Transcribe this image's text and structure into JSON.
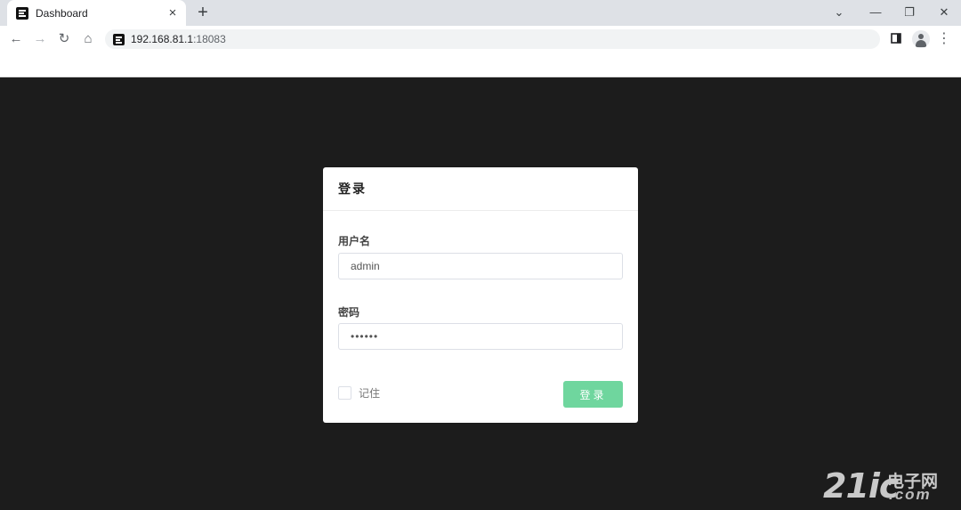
{
  "browser": {
    "tab_title": "Dashboard",
    "tab_close": "×",
    "new_tab": "+",
    "url_host": "192.168.81.1",
    "url_port": ":18083",
    "window_controls": {
      "chevron": "⌄",
      "minimize": "—",
      "restore": "❐",
      "close": "✕"
    },
    "nav": {
      "back": "←",
      "forward": "→",
      "reload": "↻",
      "home": "⌂"
    },
    "menu": "⋮"
  },
  "login": {
    "title": "登录",
    "username_label": "用户名",
    "username_value": "admin",
    "password_label": "密码",
    "password_value": "••••••",
    "remember_label": "记住",
    "submit_label": "登录",
    "accent_color": "#6fd69e"
  },
  "watermark": {
    "brand_number": "21ic",
    "brand_cn": "电子网",
    "brand_suffix": ".com"
  }
}
